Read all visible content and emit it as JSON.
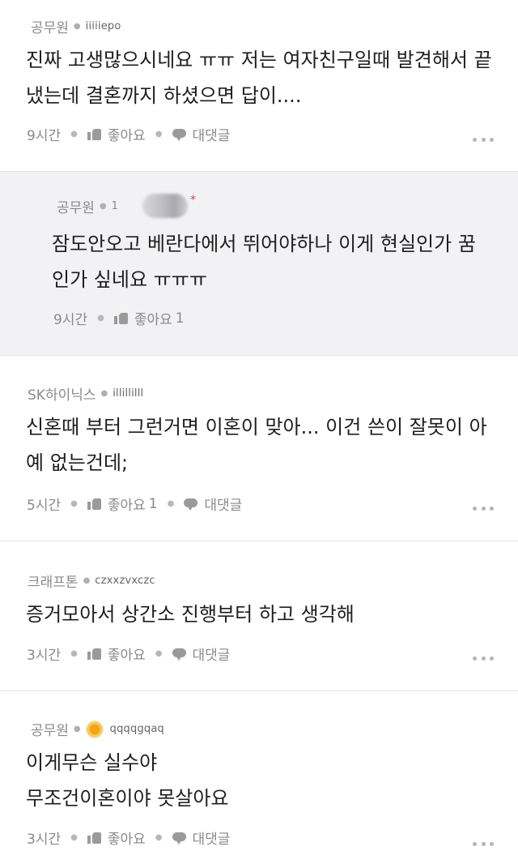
{
  "comments": [
    {
      "company": "공무원",
      "nick": "iiiiiepo",
      "body": "진짜 고생많으시네요 ㅠㅠ 저는 여자친구일때 발견해서 끝\n냈는데 결혼까지 하셨으면 답이....",
      "time": "9시간",
      "like_label": "좋아요",
      "like_count": "",
      "reply_label": "대댓글",
      "more_icon": "more-dots-icon"
    },
    {
      "company": "공무원",
      "reply_count": "1",
      "body": "잠도안오고 베란다에서 뛰어야하나 이게 현실인가 꿈\n인가 싶네요 ㅠㅠㅠ",
      "time": "9시간",
      "like_label": "좋아요",
      "like_count": "1",
      "red_mark": "*"
    },
    {
      "company": "SK하이닉스",
      "nick": "illillilll",
      "body": "신혼때 부터 그런거면 이혼이 맞아... 이건 쓴이 잘못이 아\n예 없는건데;",
      "time": "5시간",
      "like_label": "좋아요",
      "like_count": "1",
      "reply_label": "대댓글"
    },
    {
      "company": "크래프톤",
      "nick": "czxxzvxczc",
      "body": "증거모아서 상간소 진행부터 하고 생각해",
      "time": "3시간",
      "like_label": "좋아요",
      "like_count": "",
      "reply_label": "대댓글"
    },
    {
      "company": "공무원",
      "nick": "qqqqgqaq",
      "body": "이게무슨 실수야\n무조건이혼이야 못살아요",
      "time": "3시간",
      "like_label": "좋아요",
      "like_count": "",
      "reply_label": "대댓글"
    }
  ],
  "colors": {
    "reply_bg": "#f2f2f4",
    "red_mark": "#e23b3b",
    "badge": "#f2a516"
  }
}
